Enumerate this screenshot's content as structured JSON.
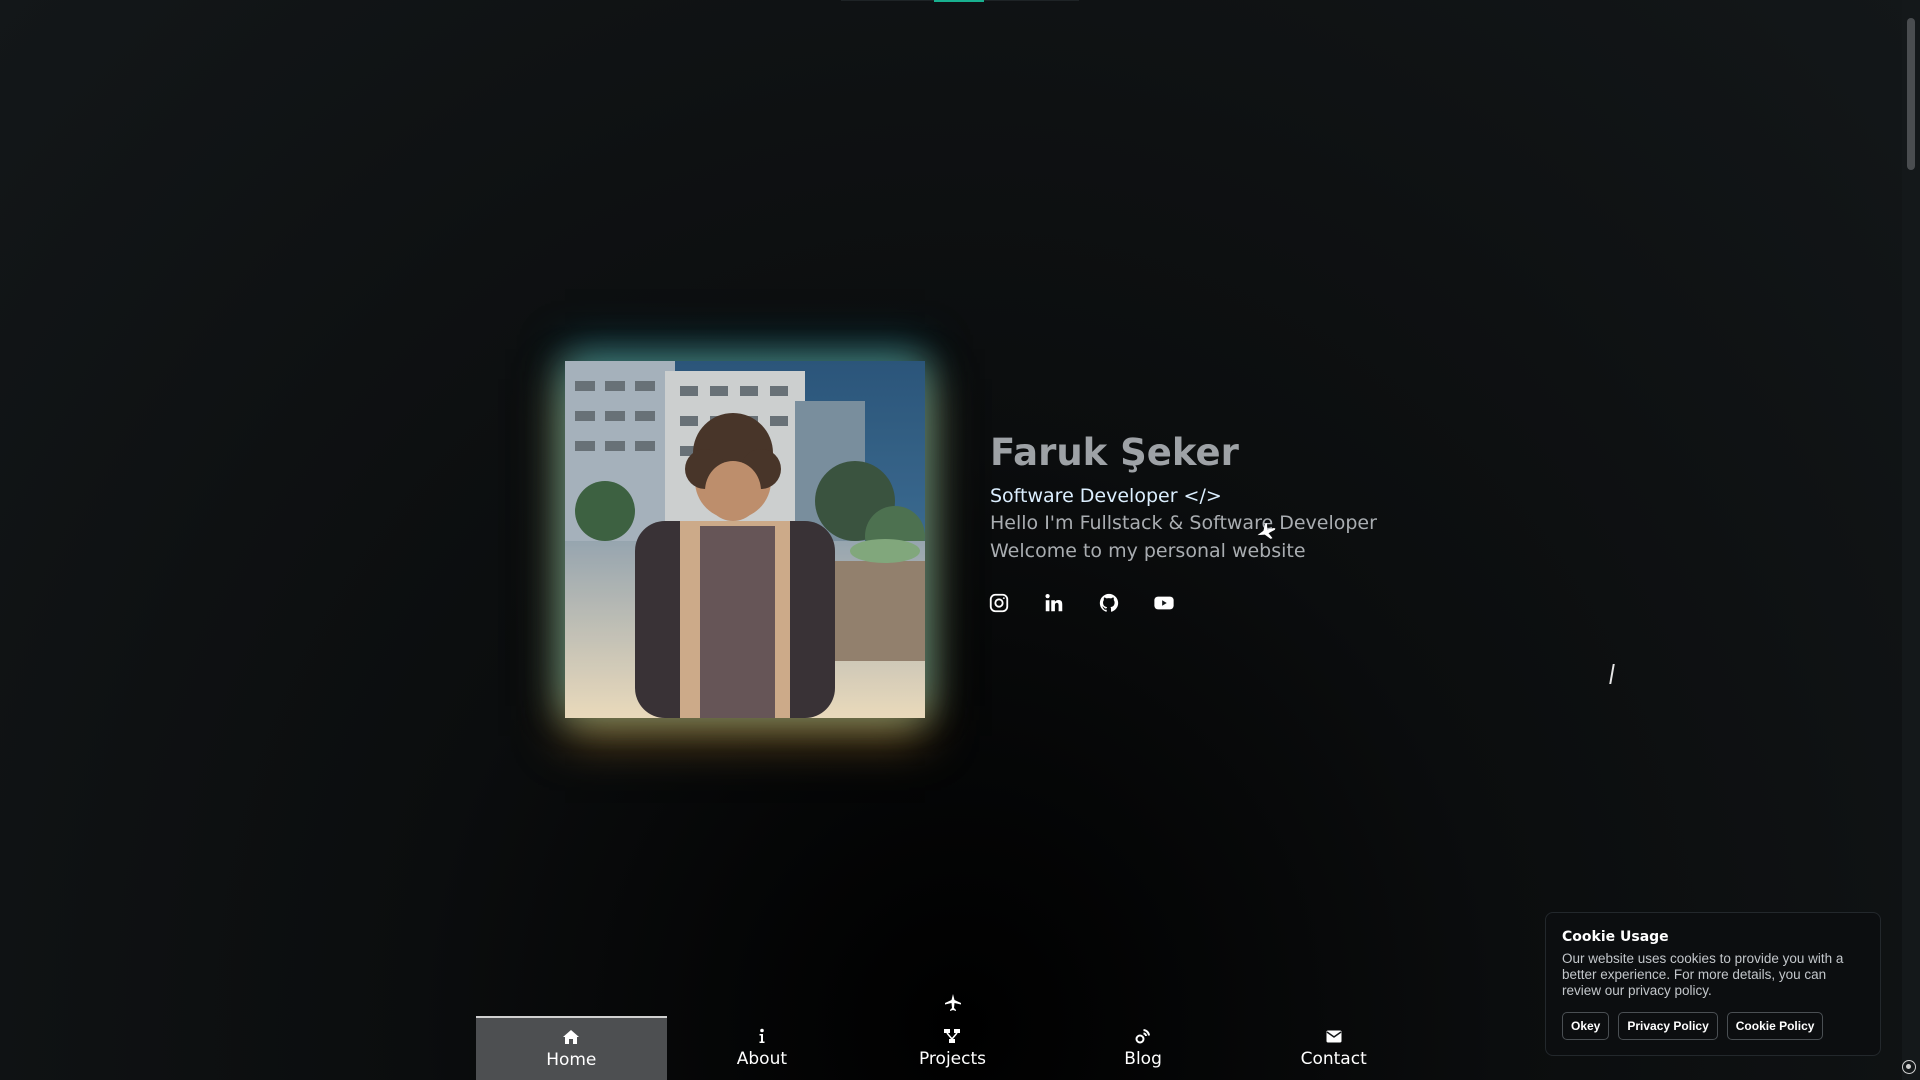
{
  "profile": {
    "name": "Faruk Şeker",
    "role": "Software Developer </>",
    "line1": "Hello I'm Fullstack & Software Developer",
    "line2": "Welcome to my personal website",
    "photo_alt": "Profile photo"
  },
  "socials": [
    {
      "icon": "instagram-icon"
    },
    {
      "icon": "linkedin-icon"
    },
    {
      "icon": "github-icon"
    },
    {
      "icon": "youtube-icon"
    }
  ],
  "nav": {
    "items": [
      {
        "label": "Home",
        "icon": "home-icon",
        "active": true
      },
      {
        "label": "About",
        "icon": "info-icon",
        "active": false
      },
      {
        "label": "Projects",
        "icon": "sitemap-icon",
        "active": false
      },
      {
        "label": "Blog",
        "icon": "blog-icon",
        "active": false
      },
      {
        "label": "Contact",
        "icon": "envelope-icon",
        "active": false
      }
    ]
  },
  "cookie": {
    "title": "Cookie Usage",
    "text": "Our website uses cookies to provide you with a better experience. For more details, you can review our privacy policy.",
    "buttons": {
      "okey": "Okey",
      "privacy": "Privacy Policy",
      "cookie_policy": "Cookie Policy"
    }
  },
  "colors": {
    "accent": "#18b08f",
    "background": "#131719",
    "active_nav": "#4d4f51"
  }
}
